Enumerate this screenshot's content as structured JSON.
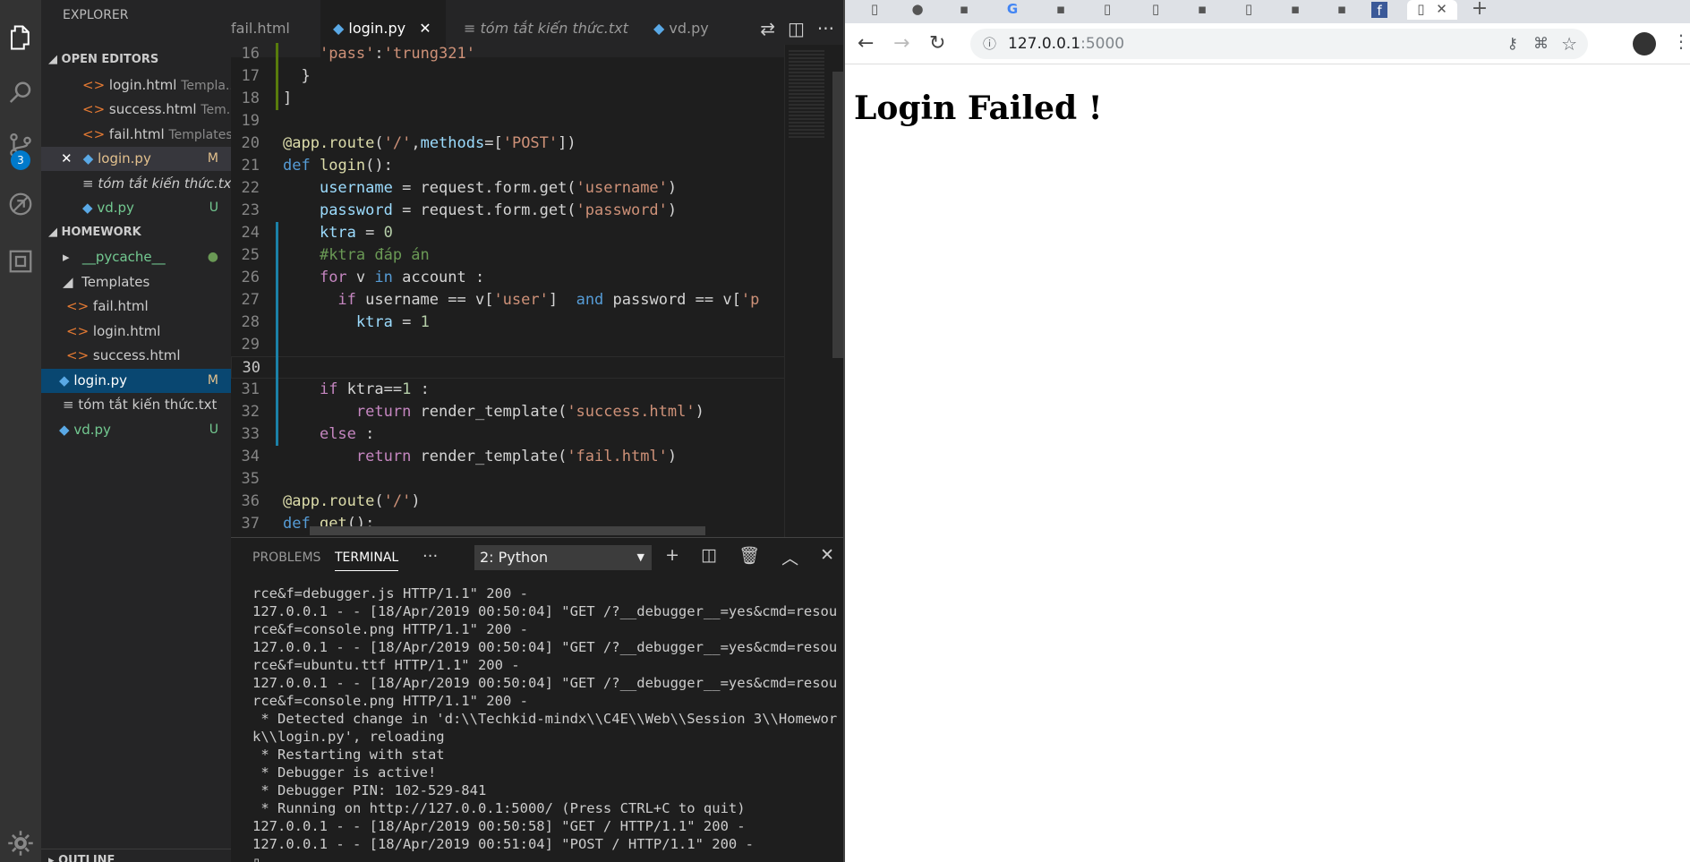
{
  "activity": {
    "scm_badge": "3"
  },
  "sidebar": {
    "title": "EXPLORER",
    "open_editors_label": "OPEN EDITORS",
    "open_editors": [
      {
        "name": "login.html",
        "detail": "Templa...",
        "icon": "html-icon"
      },
      {
        "name": "success.html",
        "detail": "Tem...",
        "icon": "html-icon"
      },
      {
        "name": "fail.html",
        "detail": "Templates",
        "icon": "html-icon"
      },
      {
        "name": "login.py",
        "detail": "",
        "mark": "M",
        "icon": "python-icon"
      },
      {
        "name": "tóm tắt kiến thức.txt",
        "detail": "",
        "icon": "text-file-icon"
      },
      {
        "name": "vd.py",
        "detail": "",
        "mark": "U",
        "icon": "python-icon"
      }
    ],
    "close_glyph": "✕",
    "workspace_label": "HOMEWORK",
    "tree": [
      {
        "name": "__pycache__",
        "kind": "folder-collapsed"
      },
      {
        "name": "Templates",
        "kind": "folder-open"
      },
      {
        "name": "fail.html",
        "kind": "html"
      },
      {
        "name": "login.html",
        "kind": "html"
      },
      {
        "name": "success.html",
        "kind": "html"
      },
      {
        "name": "login.py",
        "kind": "py",
        "mark": "M"
      },
      {
        "name": "tóm tắt kiến thức.txt",
        "kind": "txt"
      },
      {
        "name": "vd.py",
        "kind": "py",
        "mark": "U"
      }
    ],
    "outline_label": "OUTLINE"
  },
  "editor": {
    "tabs": [
      {
        "label": "fail.html"
      },
      {
        "label": "login.py",
        "close": "✕"
      },
      {
        "label": "tóm tắt kiến thức.txt"
      },
      {
        "label": "vd.py"
      }
    ],
    "lines": [
      {
        "n": "16",
        "html": "    <span class='str'>'pass'</span><span class='txt'>:</span><span class='str'>'trung321'</span>"
      },
      {
        "n": "17",
        "html": "  <span class='txt'>}</span>"
      },
      {
        "n": "18",
        "html": "<span class='txt'>]</span>"
      },
      {
        "n": "19",
        "html": ""
      },
      {
        "n": "20",
        "html": "<span class='fn'>@app.route</span><span class='txt'>(</span><span class='str'>'/'</span><span class='txt'>,</span><span class='var'>methods</span><span class='txt'>=[</span><span class='str'>'POST'</span><span class='txt'>])</span>"
      },
      {
        "n": "21",
        "html": "<span class='kw'>def</span> <span class='fn'>login</span><span class='txt'>():</span>"
      },
      {
        "n": "22",
        "html": "    <span class='var'>username</span><span class='txt'> = request.form.get(</span><span class='str'>'username'</span><span class='txt'>)</span>"
      },
      {
        "n": "23",
        "html": "    <span class='var'>password</span><span class='txt'> = request.form.get(</span><span class='str'>'password'</span><span class='txt'>)</span>"
      },
      {
        "n": "24",
        "html": "    <span class='var'>ktra</span><span class='txt'> = </span><span class='num'>0</span>"
      },
      {
        "n": "25",
        "html": "    <span class='cm'>#ktra đáp án</span>"
      },
      {
        "n": "26",
        "html": "    <span class='kw2'>for</span><span class='txt'> v </span><span class='kw'>in</span><span class='txt'> account :</span>"
      },
      {
        "n": "27",
        "html": "      <span class='kw2'>if</span><span class='txt'> username == v[</span><span class='str'>'user'</span><span class='txt'>]  </span><span class='kw'>and</span><span class='txt'> password == v[</span><span class='str'>'p</span>"
      },
      {
        "n": "28",
        "html": "        <span class='var'>ktra</span><span class='txt'> = </span><span class='num'>1</span>"
      },
      {
        "n": "29",
        "html": ""
      },
      {
        "n": "30",
        "html": ""
      },
      {
        "n": "31",
        "html": "    <span class='kw2'>if</span><span class='txt'> ktra==</span><span class='num'>1</span><span class='txt'> :</span>"
      },
      {
        "n": "32",
        "html": "        <span class='kw2'>return</span><span class='txt'> render_template(</span><span class='str'>'success.html'</span><span class='txt'>)</span>"
      },
      {
        "n": "33",
        "html": "    <span class='kw2'>else</span><span class='txt'> :</span>"
      },
      {
        "n": "34",
        "html": "        <span class='kw2'>return</span><span class='txt'> render_template(</span><span class='str'>'fail.html'</span><span class='txt'>)</span>"
      },
      {
        "n": "35",
        "html": ""
      },
      {
        "n": "36",
        "html": "<span class='fn'>@app.route</span><span class='txt'>(</span><span class='str'>'/'</span><span class='txt'>)</span>"
      },
      {
        "n": "37",
        "html": "<span class='kw'>def</span> <span class='fn'>get</span><span class='txt'>():</span>"
      }
    ]
  },
  "panel": {
    "tabs": [
      "PROBLEMS",
      "TERMINAL"
    ],
    "more": "···",
    "terminal_select": "2: Python",
    "terminal_lines": [
      "rce&f=debugger.js HTTP/1.1\" 200 -",
      "127.0.0.1 - - [18/Apr/2019 00:50:04] \"GET /?__debugger__=yes&cmd=resou",
      "rce&f=console.png HTTP/1.1\" 200 -",
      "127.0.0.1 - - [18/Apr/2019 00:50:04] \"GET /?__debugger__=yes&cmd=resou",
      "rce&f=ubuntu.ttf HTTP/1.1\" 200 -",
      "127.0.0.1 - - [18/Apr/2019 00:50:04] \"GET /?__debugger__=yes&cmd=resou",
      "rce&f=console.png HTTP/1.1\" 200 -",
      " * Detected change in 'd:\\\\Techkid-mindx\\\\C4E\\\\Web\\\\Session 3\\\\Homewor",
      "k\\\\login.py', reloading",
      " * Restarting with stat",
      " * Debugger is active!",
      " * Debugger PIN: 102-529-841",
      " * Running on http://127.0.0.1:5000/ (Press CTRL+C to quit)",
      "127.0.0.1 - - [18/Apr/2019 00:50:58] \"GET / HTTP/1.1\" 200 -",
      "127.0.0.1 - - [18/Apr/2019 00:51:04] \"POST / HTTP/1.1\" 200 -",
      "▯"
    ]
  },
  "browser": {
    "new_tab": "+",
    "active_tab_close": "✕",
    "url_host": "127.0.0.1",
    "url_port": ":5000",
    "heading": "Login Failed !"
  }
}
